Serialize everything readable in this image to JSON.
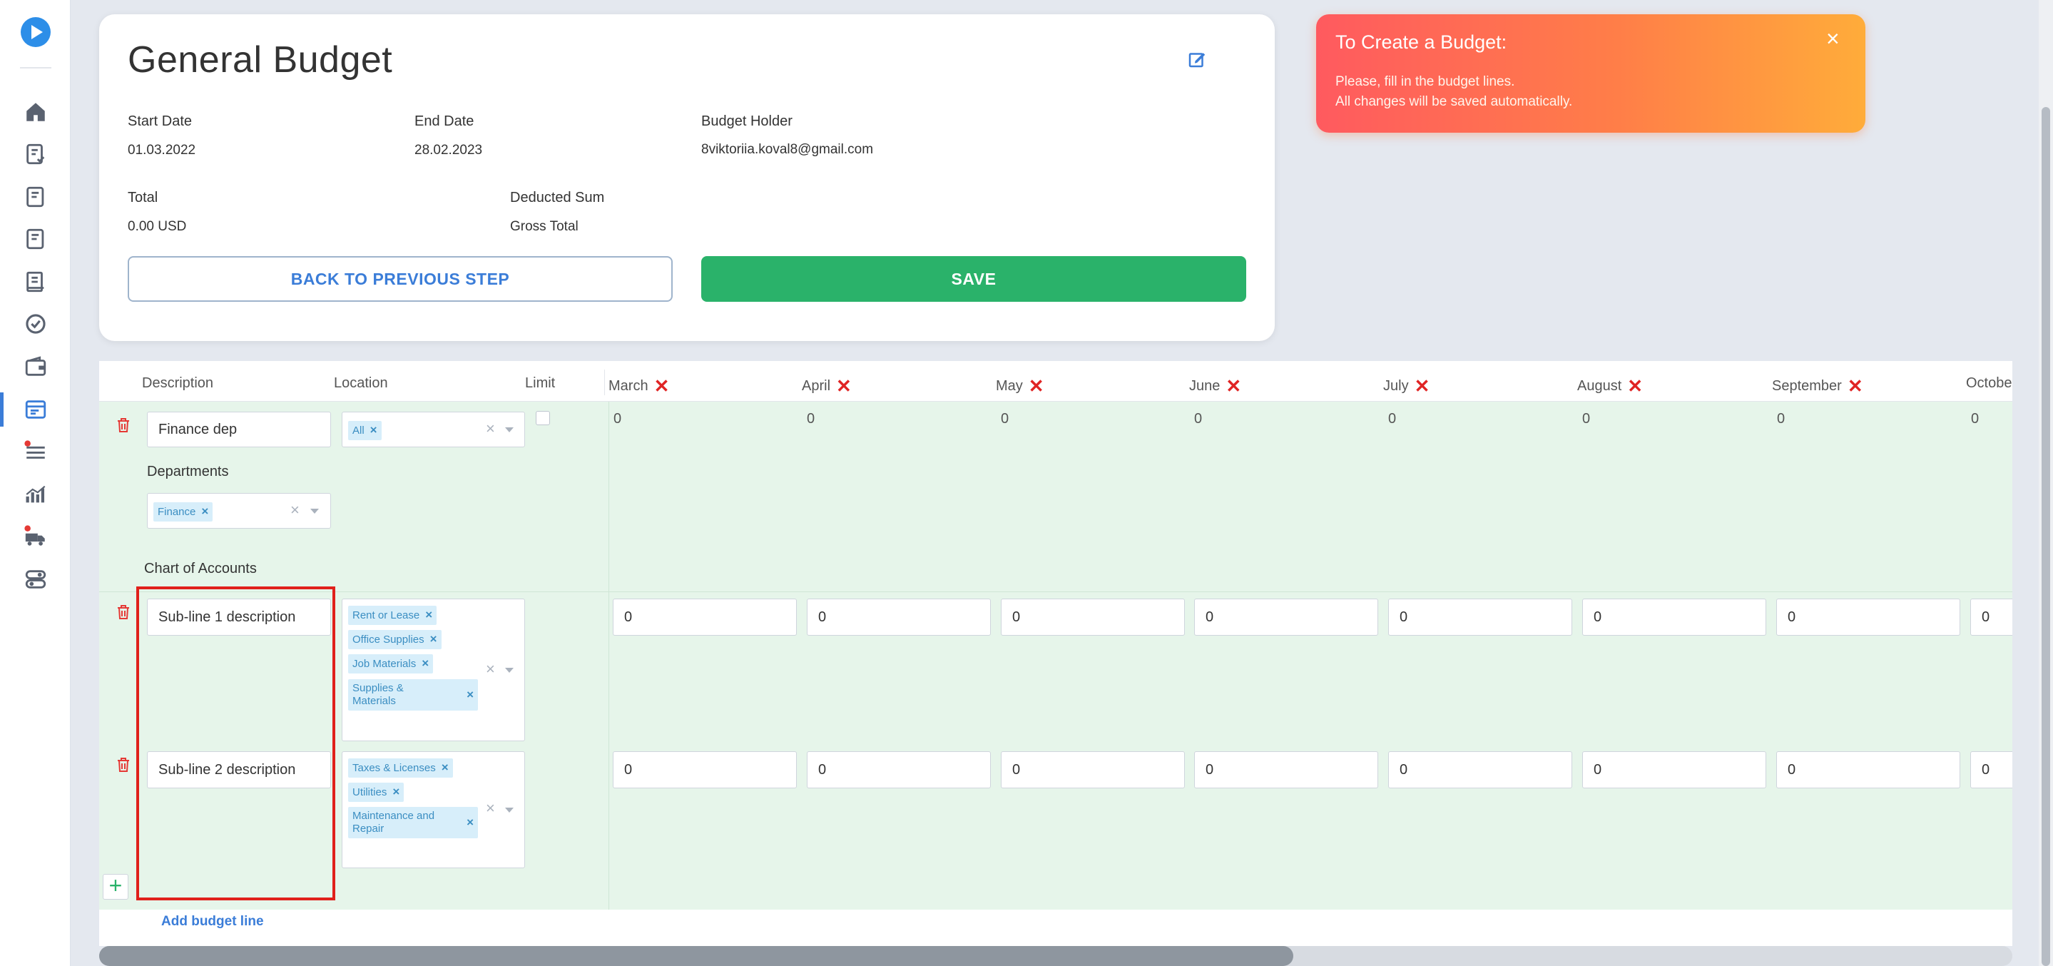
{
  "sidebar": {
    "logo": "play-logo",
    "items": [
      "home-icon",
      "budget-check-icon",
      "budget-icon",
      "budget-alt-icon",
      "report-icon",
      "check-circle-icon",
      "wallet-icon",
      "budgets-icon",
      "list-icon",
      "analytics-icon",
      "delivery-icon",
      "settings-toggle-icon"
    ],
    "active_index": 7
  },
  "header": {
    "title": "General Budget",
    "start_date_label": "Start Date",
    "start_date": "01.03.2022",
    "end_date_label": "End Date",
    "end_date": "28.02.2023",
    "holder_label": "Budget Holder",
    "holder": "8viktoriia.koval8@gmail.com",
    "total_label": "Total",
    "total": "0.00 USD",
    "deducted_label": "Deducted Sum",
    "deducted": "Gross Total",
    "back_label": "BACK TO PREVIOUS STEP",
    "save_label": "SAVE"
  },
  "toast": {
    "title": "To Create a Budget:",
    "line1": "Please, fill in the budget lines.",
    "line2": "All changes will be saved automatically.",
    "close": "×"
  },
  "table": {
    "headers": {
      "description": "Description",
      "location": "Location",
      "limit": "Limit"
    },
    "months": [
      "March",
      "April",
      "May",
      "June",
      "July",
      "August",
      "September",
      "Octobe"
    ],
    "month_remove": "✕",
    "line": {
      "description": "Finance dep",
      "location_tags": [
        "All"
      ],
      "departments_label": "Departments",
      "department_tags": [
        "Finance"
      ],
      "chart_label": "Chart of Accounts",
      "values": [
        "0",
        "0",
        "0",
        "0",
        "0",
        "0",
        "0",
        "0"
      ]
    },
    "sublines": [
      {
        "description": "Sub-line 1 description",
        "tags": [
          "Rent or Lease",
          "Office Supplies",
          "Job Materials",
          "Supplies &\nMaterials"
        ],
        "values": [
          "0",
          "0",
          "0",
          "0",
          "0",
          "0",
          "0",
          "0"
        ]
      },
      {
        "description": "Sub-line 2 description",
        "tags": [
          "Taxes & Licenses",
          "Utilities",
          "Maintenance and\nRepair"
        ],
        "values": [
          "0",
          "0",
          "0",
          "0",
          "0",
          "0",
          "0",
          "0"
        ]
      }
    ],
    "tag_remove": "×",
    "add_label": "Add budget line",
    "add_icon": "+"
  },
  "colors": {
    "accent": "#3b7dd8",
    "save": "#2ab26a",
    "row_bg": "#e6f5ea",
    "highlight": "#e0201b"
  }
}
